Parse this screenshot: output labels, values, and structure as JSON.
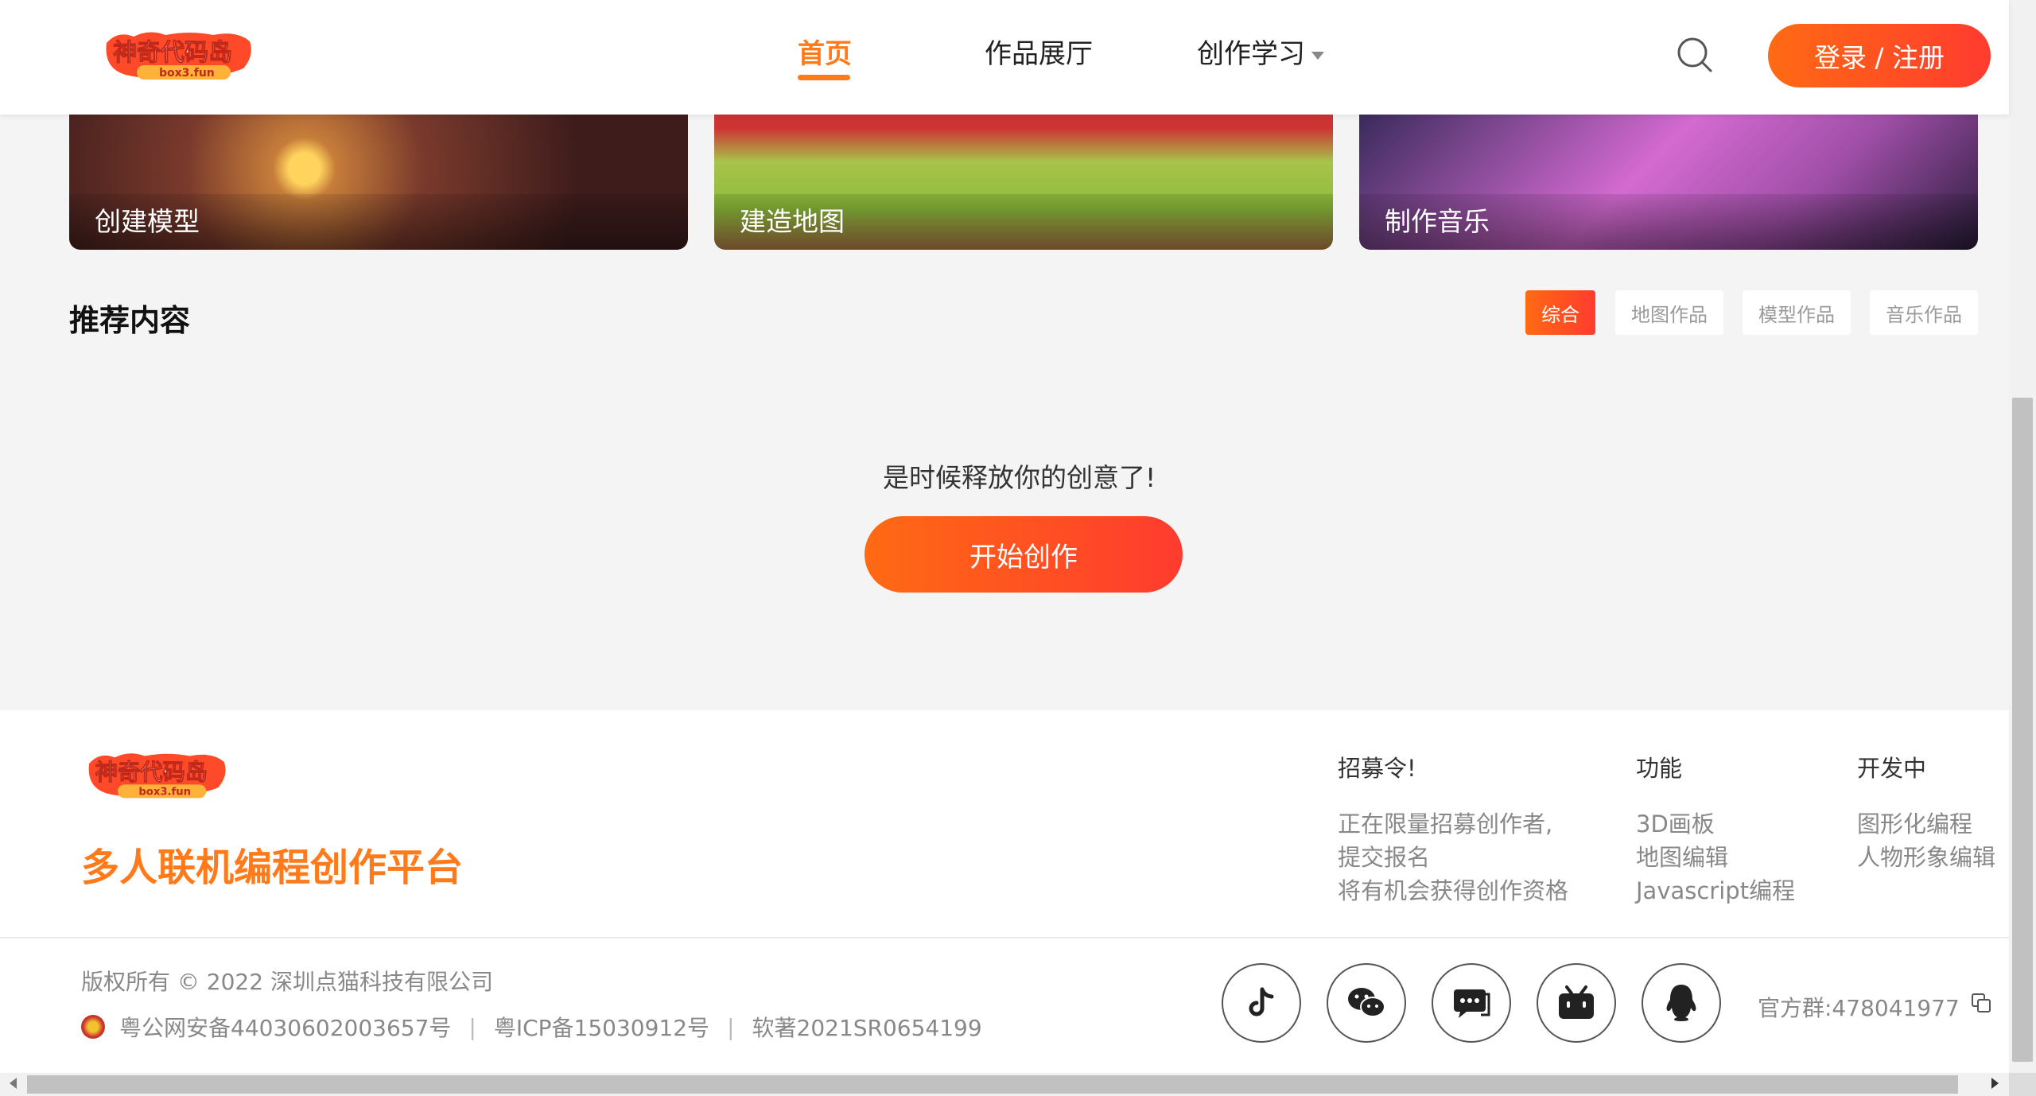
{
  "header": {
    "logo_text": "神奇代码岛",
    "logo_sub": "box3.fun",
    "nav": [
      {
        "label": "首页",
        "active": true
      },
      {
        "label": "作品展厅",
        "active": false
      },
      {
        "label": "创作学习",
        "active": false,
        "dropdown": true
      }
    ],
    "login_label": "登录 / 注册"
  },
  "cards": [
    {
      "label": "创建模型"
    },
    {
      "label": "建造地图"
    },
    {
      "label": "制作音乐"
    }
  ],
  "recommend": {
    "title": "推荐内容",
    "tabs": [
      {
        "label": "综合",
        "active": true
      },
      {
        "label": "地图作品",
        "active": false
      },
      {
        "label": "模型作品",
        "active": false
      },
      {
        "label": "音乐作品",
        "active": false
      }
    ],
    "empty_text": "是时候释放你的创意了!",
    "start_label": "开始创作"
  },
  "footer": {
    "slogan": "多人联机编程创作平台",
    "columns": [
      {
        "title": "招募令!",
        "items": [
          "正在限量招募创作者,",
          "提交报名",
          "将有机会获得创作资格"
        ]
      },
      {
        "title": "功能",
        "items": [
          "3D画板",
          "地图编辑",
          "Javascript编程"
        ]
      },
      {
        "title": "开发中",
        "items": [
          "图形化编程",
          "人物形象编辑"
        ]
      }
    ],
    "copyright": "版权所有 © 2022 深圳点猫科技有限公司",
    "records": [
      "粤公网安备44030602003657号",
      "粤ICP备15030912号",
      "软著2021SR0654199"
    ],
    "separator": "|",
    "social_icons": [
      "tiktok-icon",
      "wechat-icon",
      "chat-icon",
      "bilibili-icon",
      "qq-icon"
    ],
    "group_label": "官方群:478041977"
  },
  "colors": {
    "accent": "#ff7a1a",
    "accent_gradient_end": "#ff3b2f"
  }
}
